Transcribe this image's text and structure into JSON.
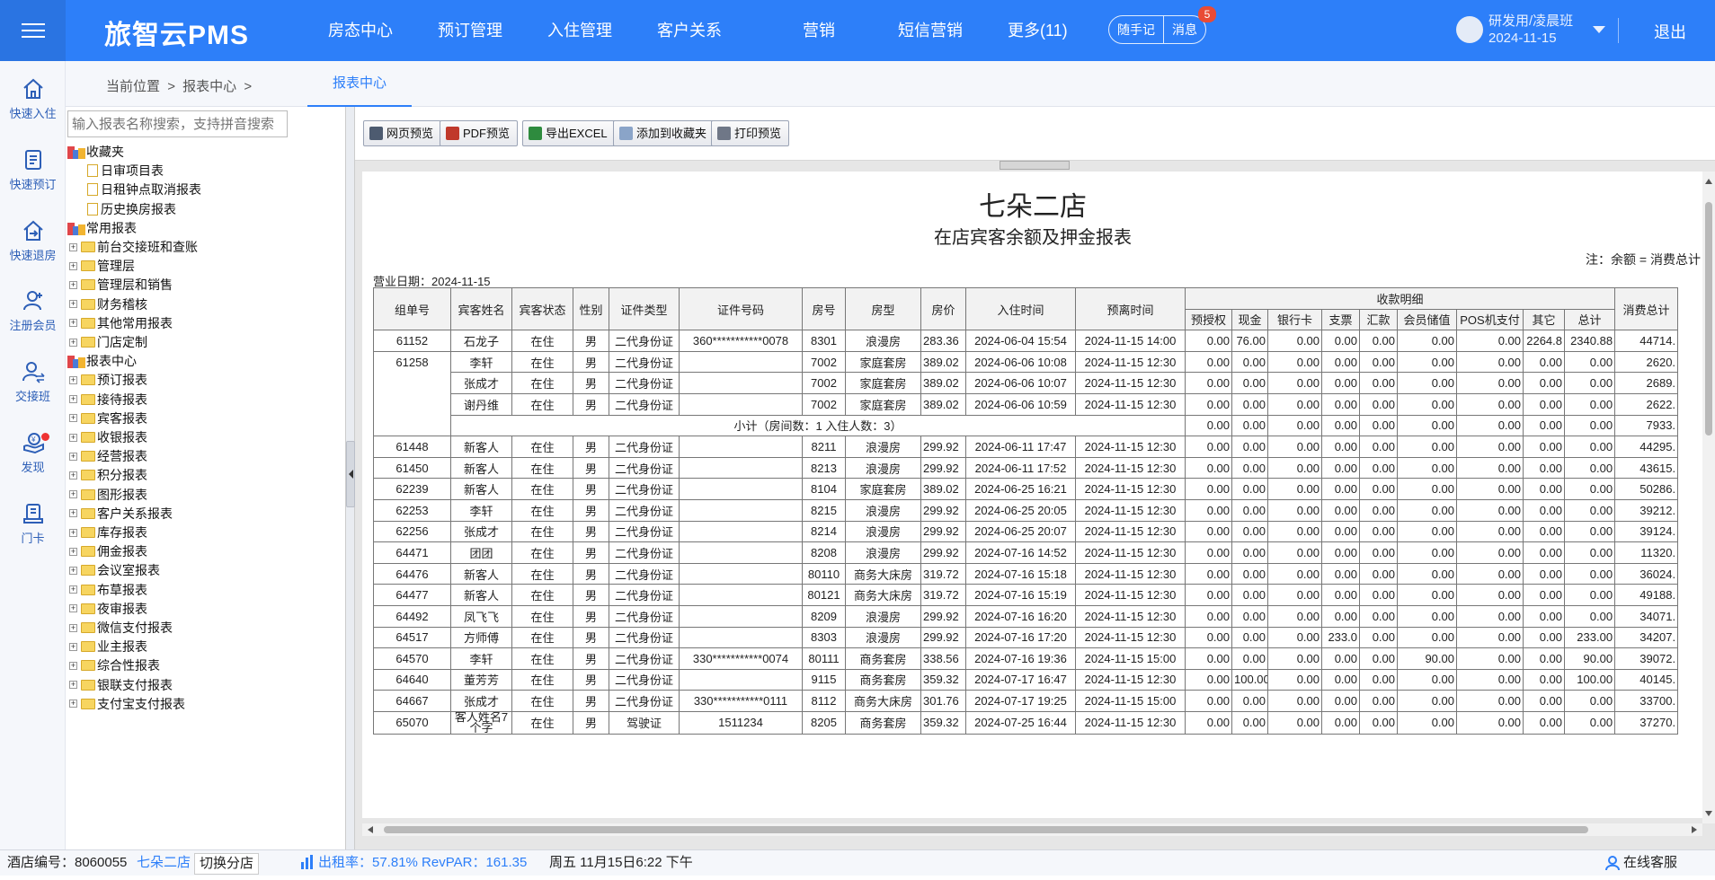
{
  "header": {
    "brand": "旅智云PMS",
    "nav": [
      "房态中心",
      "预订管理",
      "入住管理",
      "客户关系",
      "营销",
      "短信营销",
      "更多(11)"
    ],
    "notes_label": "随手记",
    "messages_label": "消息",
    "messages_badge": "5",
    "user_name": "研发用/凌晨班",
    "user_date": "2024-11-15",
    "logout_label": "退出"
  },
  "quick_actions": [
    {
      "label": "快速入住",
      "icon": "home-icon"
    },
    {
      "label": "快速预订",
      "icon": "booking-icon"
    },
    {
      "label": "快速退房",
      "icon": "checkout-icon"
    },
    {
      "label": "注册会员",
      "icon": "add-member-icon"
    },
    {
      "label": "交接班",
      "icon": "shift-handover-icon"
    },
    {
      "label": "发现",
      "icon": "discover-icon"
    },
    {
      "label": "门卡",
      "icon": "room-card-icon"
    }
  ],
  "breadcrumb": {
    "prefix": "当前位置",
    "path": "报表中心",
    "sep": ">",
    "active_tab": "报表中心"
  },
  "tree": {
    "search_placeholder": "输入报表名称搜索，支持拼音搜索",
    "favorites_label": "收藏夹",
    "favorites": [
      "日审项目表",
      "日租钟点取消报表",
      "历史换房报表"
    ],
    "common_label": "常用报表",
    "common": [
      "前台交接班和查账",
      "管理层",
      "管理层和销售",
      "财务稽核",
      "其他常用报表",
      "门店定制"
    ],
    "center_label": "报表中心",
    "center": [
      "预订报表",
      "接待报表",
      "宾客报表",
      "收银报表",
      "经营报表",
      "积分报表",
      "图形报表",
      "客户关系报表",
      "库存报表",
      "佣金报表",
      "会议室报表",
      "布草报表",
      "夜审报表",
      "微信支付报表",
      "业主报表",
      "综合性报表",
      "银联支付报表",
      "支付宝支付报表"
    ]
  },
  "toolbar": {
    "web_preview": "网页预览",
    "pdf_preview": "PDF预览",
    "export_excel": "导出EXCEL",
    "add_favorite": "添加到收藏夹",
    "print_preview": "打印预览"
  },
  "report": {
    "hotel": "七朵二店",
    "title": "在店宾客余额及押金报表",
    "note": "注：余额 = 消费总计",
    "biz_date": "营业日期：2024-11-15",
    "headers": [
      "组单号",
      "宾客姓名",
      "宾客状态",
      "性别",
      "证件类型",
      "证件号码",
      "房号",
      "房型",
      "房价",
      "入住时间",
      "预离时间"
    ],
    "payment_group": "收款明细",
    "payment_headers": [
      "预授权",
      "现金",
      "银行卡",
      "支票",
      "汇款",
      "会员储值",
      "POS机支付",
      "其它",
      "总计"
    ],
    "last_header": "消费总计",
    "rows": [
      {
        "g": "61152",
        "name": "石龙子",
        "st": "在住",
        "sex": "男",
        "idt": "二代身份证",
        "idn": "360***********0078",
        "room": "8301",
        "type": "浪漫房",
        "price": "283.36",
        "in": "2024-06-04 15:54",
        "out": "2024-11-15 14:00",
        "p": [
          "0.00",
          "76.00",
          "0.00",
          "0.00",
          "0.00",
          "0.00",
          "0.00",
          "2264.8",
          "2340.88"
        ],
        "cons": "44714."
      },
      {
        "g": "61258",
        "name": "李轩",
        "st": "在住",
        "sex": "男",
        "idt": "二代身份证",
        "idn": "",
        "room": "7002",
        "type": "家庭套房",
        "price": "389.02",
        "in": "2024-06-06 10:08",
        "out": "2024-11-15 12:30",
        "p": [
          "0.00",
          "0.00",
          "0.00",
          "0.00",
          "0.00",
          "0.00",
          "0.00",
          "0.00",
          "0.00"
        ],
        "cons": "2620."
      },
      {
        "g": "",
        "name": "张成才",
        "st": "在住",
        "sex": "男",
        "idt": "二代身份证",
        "idn": "",
        "room": "7002",
        "type": "家庭套房",
        "price": "389.02",
        "in": "2024-06-06 10:07",
        "out": "2024-11-15 12:30",
        "p": [
          "0.00",
          "0.00",
          "0.00",
          "0.00",
          "0.00",
          "0.00",
          "0.00",
          "0.00",
          "0.00"
        ],
        "cons": "2689."
      },
      {
        "g": "",
        "name": "谢丹维",
        "st": "在住",
        "sex": "男",
        "idt": "二代身份证",
        "idn": "",
        "room": "7002",
        "type": "家庭套房",
        "price": "389.02",
        "in": "2024-06-06 10:59",
        "out": "2024-11-15 12:30",
        "p": [
          "0.00",
          "0.00",
          "0.00",
          "0.00",
          "0.00",
          "0.00",
          "0.00",
          "0.00",
          "0.00"
        ],
        "cons": "2622."
      },
      {
        "subtotal": "小计（房间数：1    入住人数：3）",
        "p": [
          "0.00",
          "0.00",
          "0.00",
          "0.00",
          "0.00",
          "0.00",
          "0.00",
          "0.00",
          "0.00"
        ],
        "cons": "7933."
      },
      {
        "g": "61448",
        "name": "新客人",
        "st": "在住",
        "sex": "男",
        "idt": "二代身份证",
        "idn": "",
        "room": "8211",
        "type": "浪漫房",
        "price": "299.92",
        "in": "2024-06-11 17:47",
        "out": "2024-11-15 12:30",
        "p": [
          "0.00",
          "0.00",
          "0.00",
          "0.00",
          "0.00",
          "0.00",
          "0.00",
          "0.00",
          "0.00"
        ],
        "cons": "44295."
      },
      {
        "g": "61450",
        "name": "新客人",
        "st": "在住",
        "sex": "男",
        "idt": "二代身份证",
        "idn": "",
        "room": "8213",
        "type": "浪漫房",
        "price": "299.92",
        "in": "2024-06-11 17:52",
        "out": "2024-11-15 12:30",
        "p": [
          "0.00",
          "0.00",
          "0.00",
          "0.00",
          "0.00",
          "0.00",
          "0.00",
          "0.00",
          "0.00"
        ],
        "cons": "43615."
      },
      {
        "g": "62239",
        "name": "新客人",
        "st": "在住",
        "sex": "男",
        "idt": "二代身份证",
        "idn": "",
        "room": "8104",
        "type": "家庭套房",
        "price": "389.02",
        "in": "2024-06-25 16:21",
        "out": "2024-11-15 12:30",
        "p": [
          "0.00",
          "0.00",
          "0.00",
          "0.00",
          "0.00",
          "0.00",
          "0.00",
          "0.00",
          "0.00"
        ],
        "cons": "50286."
      },
      {
        "g": "62253",
        "name": "李轩",
        "st": "在住",
        "sex": "男",
        "idt": "二代身份证",
        "idn": "",
        "room": "8215",
        "type": "浪漫房",
        "price": "299.92",
        "in": "2024-06-25 20:05",
        "out": "2024-11-15 12:30",
        "p": [
          "0.00",
          "0.00",
          "0.00",
          "0.00",
          "0.00",
          "0.00",
          "0.00",
          "0.00",
          "0.00"
        ],
        "cons": "39212."
      },
      {
        "g": "62256",
        "name": "张成才",
        "st": "在住",
        "sex": "男",
        "idt": "二代身份证",
        "idn": "",
        "room": "8214",
        "type": "浪漫房",
        "price": "299.92",
        "in": "2024-06-25 20:07",
        "out": "2024-11-15 12:30",
        "p": [
          "0.00",
          "0.00",
          "0.00",
          "0.00",
          "0.00",
          "0.00",
          "0.00",
          "0.00",
          "0.00"
        ],
        "cons": "39124."
      },
      {
        "g": "64471",
        "name": "团团",
        "st": "在住",
        "sex": "男",
        "idt": "二代身份证",
        "idn": "",
        "room": "8208",
        "type": "浪漫房",
        "price": "299.92",
        "in": "2024-07-16 14:52",
        "out": "2024-11-15 12:30",
        "p": [
          "0.00",
          "0.00",
          "0.00",
          "0.00",
          "0.00",
          "0.00",
          "0.00",
          "0.00",
          "0.00"
        ],
        "cons": "11320."
      },
      {
        "g": "64476",
        "name": "新客人",
        "st": "在住",
        "sex": "男",
        "idt": "二代身份证",
        "idn": "",
        "room": "80110",
        "type": "商务大床房",
        "price": "319.72",
        "in": "2024-07-16 15:18",
        "out": "2024-11-15 12:30",
        "p": [
          "0.00",
          "0.00",
          "0.00",
          "0.00",
          "0.00",
          "0.00",
          "0.00",
          "0.00",
          "0.00"
        ],
        "cons": "36024."
      },
      {
        "g": "64477",
        "name": "新客人",
        "st": "在住",
        "sex": "男",
        "idt": "二代身份证",
        "idn": "",
        "room": "80121",
        "type": "商务大床房",
        "price": "319.72",
        "in": "2024-07-16 15:19",
        "out": "2024-11-15 12:30",
        "p": [
          "0.00",
          "0.00",
          "0.00",
          "0.00",
          "0.00",
          "0.00",
          "0.00",
          "0.00",
          "0.00"
        ],
        "cons": "49188."
      },
      {
        "g": "64492",
        "name": "凤飞飞",
        "st": "在住",
        "sex": "男",
        "idt": "二代身份证",
        "idn": "",
        "room": "8209",
        "type": "浪漫房",
        "price": "299.92",
        "in": "2024-07-16 16:20",
        "out": "2024-11-15 12:30",
        "p": [
          "0.00",
          "0.00",
          "0.00",
          "0.00",
          "0.00",
          "0.00",
          "0.00",
          "0.00",
          "0.00"
        ],
        "cons": "34071."
      },
      {
        "g": "64517",
        "name": "方师傅",
        "st": "在住",
        "sex": "男",
        "idt": "二代身份证",
        "idn": "",
        "room": "8303",
        "type": "浪漫房",
        "price": "299.92",
        "in": "2024-07-16 17:20",
        "out": "2024-11-15 12:30",
        "p": [
          "0.00",
          "0.00",
          "0.00",
          "233.0",
          "0.00",
          "0.00",
          "0.00",
          "0.00",
          "233.00"
        ],
        "cons": "34207."
      },
      {
        "g": "64570",
        "name": "李轩",
        "st": "在住",
        "sex": "男",
        "idt": "二代身份证",
        "idn": "330***********0074",
        "room": "80111",
        "type": "商务套房",
        "price": "338.56",
        "in": "2024-07-16 19:36",
        "out": "2024-11-15 15:00",
        "p": [
          "0.00",
          "0.00",
          "0.00",
          "0.00",
          "0.00",
          "90.00",
          "0.00",
          "0.00",
          "90.00"
        ],
        "cons": "39072."
      },
      {
        "g": "64640",
        "name": "董芳芳",
        "st": "在住",
        "sex": "男",
        "idt": "二代身份证",
        "idn": "",
        "room": "9115",
        "type": "商务套房",
        "price": "359.32",
        "in": "2024-07-17 16:47",
        "out": "2024-11-15 12:30",
        "p": [
          "0.00",
          "100.00",
          "0.00",
          "0.00",
          "0.00",
          "0.00",
          "0.00",
          "0.00",
          "100.00"
        ],
        "cons": "40145."
      },
      {
        "g": "64667",
        "name": "张成才",
        "st": "在住",
        "sex": "男",
        "idt": "二代身份证",
        "idn": "330***********0111",
        "room": "8112",
        "type": "商务大床房",
        "price": "301.76",
        "in": "2024-07-17 19:25",
        "out": "2024-11-15 15:00",
        "p": [
          "0.00",
          "0.00",
          "0.00",
          "0.00",
          "0.00",
          "0.00",
          "0.00",
          "0.00",
          "0.00"
        ],
        "cons": "33700."
      },
      {
        "g": "65070",
        "name": "客人姓名7个字",
        "st": "在住",
        "sex": "男",
        "idt": "驾驶证",
        "idn": "1511234",
        "room": "8205",
        "type": "商务套房",
        "price": "359.32",
        "in": "2024-07-25 16:44",
        "out": "2024-11-15 12:30",
        "p": [
          "0.00",
          "0.00",
          "0.00",
          "0.00",
          "0.00",
          "0.00",
          "0.00",
          "0.00",
          "0.00"
        ],
        "cons": "37270."
      }
    ]
  },
  "status": {
    "hotel_code": "酒店编号：8060055",
    "hotel_name": "七朵二店",
    "switch_branch": "切换分店",
    "occupancy": "出租率：57.81% RevPAR：161.35",
    "datetime": "周五 11月15日6:22 下午",
    "support": "在线客服"
  },
  "colors": {
    "primary": "#2d7ff9",
    "badge": "#e94b35"
  }
}
